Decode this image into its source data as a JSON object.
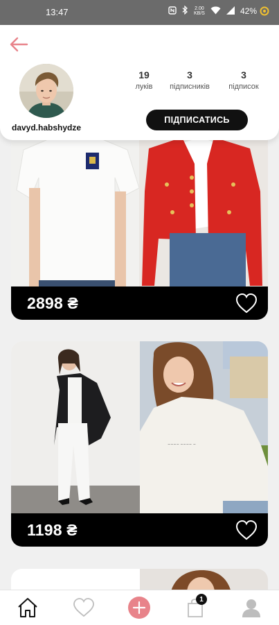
{
  "status_bar": {
    "time": "13:47",
    "network_speed": "2.00 KB/S",
    "battery": "42%"
  },
  "profile": {
    "username": "davyd.habshydze",
    "stats": [
      {
        "value": "19",
        "label": "луків"
      },
      {
        "value": "3",
        "label": "підписників"
      },
      {
        "value": "3",
        "label": "підписок"
      }
    ],
    "subscribe_label": "ПІДПИСАТИСЬ"
  },
  "feed": {
    "cards": [
      {
        "price": "2898 ₴",
        "liked": false
      },
      {
        "price": "1198 ₴",
        "liked": false
      }
    ]
  },
  "bottom_nav": {
    "cart_badge": "1",
    "icons": [
      "home-icon",
      "heart-icon",
      "plus-icon",
      "bag-icon",
      "user-icon"
    ]
  },
  "colors": {
    "accent": "#e8838a",
    "dark": "#111111",
    "status_bar": "#6b6b6b"
  }
}
